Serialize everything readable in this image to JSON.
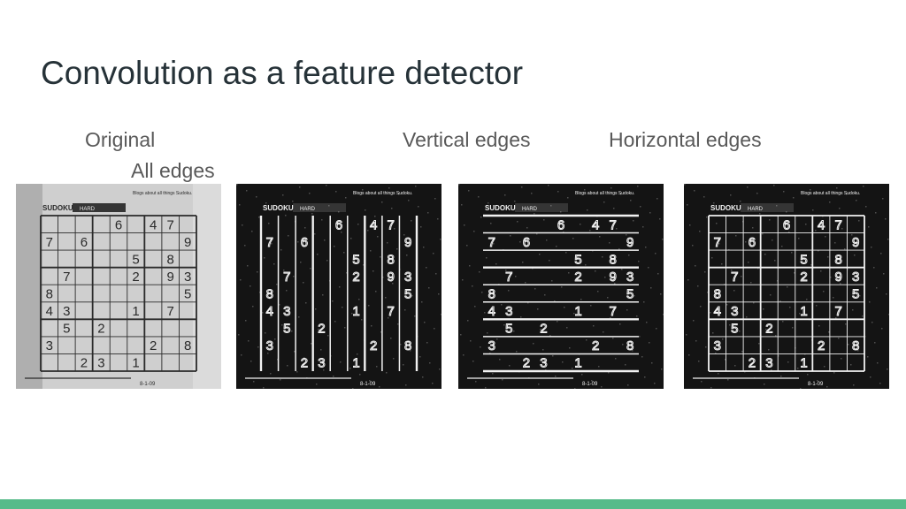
{
  "slide": {
    "title": "Convolution as a feature detector",
    "accent_color": "#57bb8a"
  },
  "labels": {
    "original": "Original",
    "all_edges": "All edges",
    "vertical_edges": "Vertical edges",
    "horizontal_edges": "Horizontal edges"
  },
  "panels": [
    {
      "name": "original",
      "mode": "original"
    },
    {
      "name": "vertical-edges",
      "mode": "vertical"
    },
    {
      "name": "horizontal-edges",
      "mode": "horizontal"
    },
    {
      "name": "all-edges",
      "mode": "all"
    }
  ],
  "sudoku": {
    "header_word": "SUDOKU",
    "difficulty": "HARD",
    "side_note": "Blogs about all things Sudoku.",
    "footer_code": "8-1-09",
    "rows": [
      "....6.47.",
      "7.6.....9",
      ".....5.8.",
      ".7...2.93",
      "8.......5",
      "43...1.7.",
      ".5.2.....",
      "3.....2.8",
      "..23.1..."
    ]
  }
}
